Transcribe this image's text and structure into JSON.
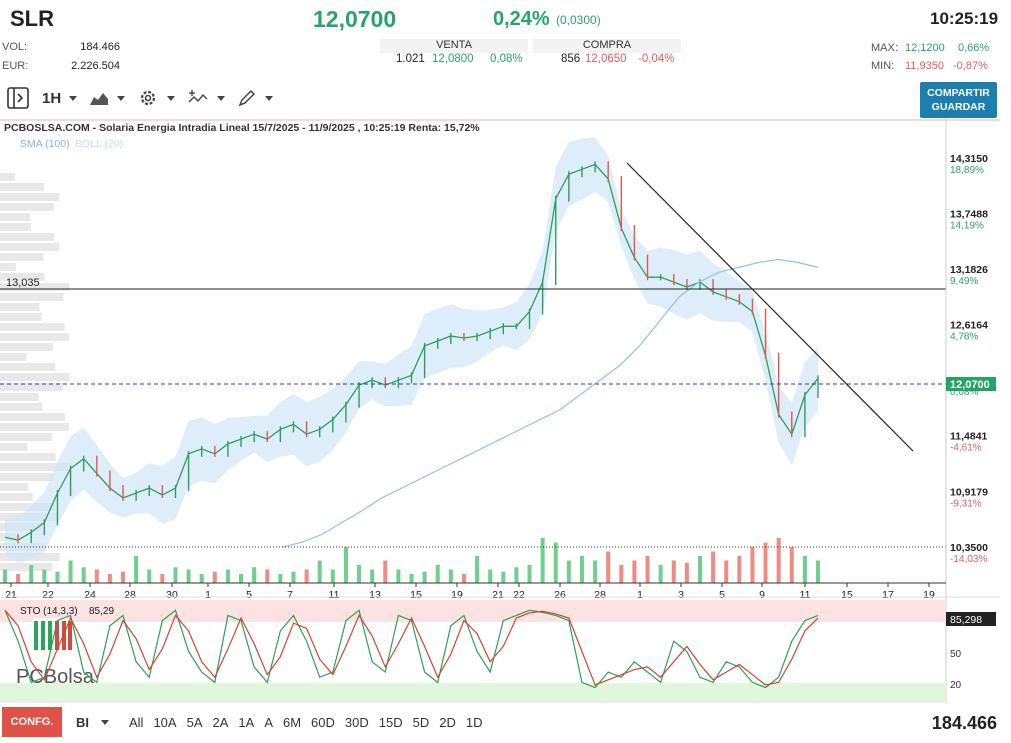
{
  "header": {
    "symbol": "SLR",
    "price": "12,0700",
    "change_pct": "0,24%",
    "change_abs": "(0,0300)",
    "time": "10:25:19"
  },
  "stats": {
    "vol_label": "VOL:",
    "vol_value": "184.466",
    "eur_label": "EUR:",
    "eur_value": "2.226.504",
    "max_label": "MAX:",
    "max_value": "12,1200",
    "max_pct": "0,66%",
    "min_label": "MIN:",
    "min_value": "11,9350",
    "min_pct": "-0,87%"
  },
  "book": {
    "venta_label": "VENTA",
    "venta_qty": "1.021",
    "venta_price": "12,0800",
    "venta_pct": "0,08%",
    "compra_label": "COMPRA",
    "compra_qty": "856",
    "compra_price": "12,0650",
    "compra_pct": "-0,04%"
  },
  "toolbar": {
    "timeframe": "1H",
    "share_line1": "COMPARTIR",
    "share_line2": "GUARDAR"
  },
  "chart_title": "PCBOSLSA.COM - Solaria Energia Intradia Lineal 15/7/2025 - 11/9/2025 , 10:25:19 Renta: 15,72%",
  "indicators_label": {
    "sma": "SMA (100)",
    "boll": "BOLL (20)"
  },
  "hline_label": "13,035",
  "last_label": "12,0700",
  "sto": {
    "label": "STO (14,3,3)",
    "value": "85,29",
    "tag": "85,298",
    "lvl50": "50",
    "lvl20": "20"
  },
  "logo": {
    "text": "PCBolsa"
  },
  "bottom": {
    "conf": "CONFG.",
    "mode": "BI",
    "ranges": [
      "All",
      "10A",
      "5A",
      "2A",
      "1A",
      "A",
      "6M",
      "60D",
      "30D",
      "15D",
      "5D",
      "2D",
      "1D"
    ],
    "volume": "184.466"
  },
  "chart_data": {
    "type": "line",
    "title": "PCBOSLSA.COM - Solaria Energia Intradia Lineal 15/7/2025 - 11/9/2025 , 10:25:19 Renta: 15,72%",
    "y_ticks": [
      {
        "v": 14.315,
        "label": "14,3150",
        "pct": "18,89%",
        "pc": "green"
      },
      {
        "v": 13.7488,
        "label": "13,7488",
        "pct": "14,19%",
        "pc": "green"
      },
      {
        "v": 13.1826,
        "label": "13,1826",
        "pct": "9,49%",
        "pc": "green"
      },
      {
        "v": 12.6164,
        "label": "12,6164",
        "pct": "4,78%",
        "pc": "green"
      },
      {
        "v": 12.0502,
        "label": "12,0502",
        "pct": "0,08%",
        "pc": "green"
      },
      {
        "v": 11.4841,
        "label": "11,4841",
        "pct": "-4,61%",
        "pc": "red"
      },
      {
        "v": 10.9179,
        "label": "10,9179",
        "pct": "-9,31%",
        "pc": "red"
      },
      {
        "v": 10.35,
        "label": "10,3500",
        "pct": "-14,03%",
        "pc": "red"
      }
    ],
    "ylim": [
      10.35,
      14.315
    ],
    "x_ticks": [
      "21",
      "22",
      "24",
      "28",
      "30",
      "1",
      "5",
      "7",
      "11",
      "13",
      "15",
      "19",
      "21",
      "22",
      "26",
      "28",
      "1",
      "3",
      "5",
      "9",
      "11",
      "15",
      "17",
      "19"
    ],
    "price_series": [
      10.45,
      10.42,
      10.5,
      10.6,
      10.9,
      11.15,
      11.25,
      11.1,
      10.95,
      10.85,
      10.9,
      10.95,
      10.88,
      10.95,
      11.3,
      11.35,
      11.3,
      11.4,
      11.45,
      11.5,
      11.45,
      11.55,
      11.6,
      11.5,
      11.55,
      11.65,
      11.8,
      12.0,
      12.05,
      12.0,
      12.05,
      12.1,
      12.4,
      12.45,
      12.5,
      12.48,
      12.5,
      12.55,
      12.6,
      12.6,
      12.75,
      13.05,
      13.9,
      14.15,
      14.2,
      14.25,
      14.1,
      13.6,
      13.3,
      13.1,
      13.1,
      13.05,
      13.0,
      13.05,
      12.95,
      12.9,
      12.85,
      12.75,
      12.3,
      11.7,
      11.5,
      11.9,
      12.07
    ],
    "sma_series": [
      10.35,
      10.4,
      10.48,
      10.6,
      10.72,
      10.85,
      10.95,
      11.05,
      11.15,
      11.25,
      11.35,
      11.45,
      11.55,
      11.65,
      11.75,
      11.9,
      12.05,
      12.2,
      12.4,
      12.65,
      12.9,
      13.05,
      13.15,
      13.2,
      13.25,
      13.28,
      13.25,
      13.2
    ],
    "volume_bars_relative": [
      0.3,
      0.2,
      0.4,
      0.3,
      0.25,
      0.5,
      0.35,
      0.3,
      0.2,
      0.25,
      0.6,
      0.3,
      0.2,
      0.35,
      0.3,
      0.2,
      0.25,
      0.3,
      0.2,
      0.35,
      0.3,
      0.2,
      0.25,
      0.3,
      0.5,
      0.3,
      0.8,
      0.4,
      0.3,
      0.5,
      0.3,
      0.2,
      0.25,
      0.4,
      0.3,
      0.2,
      0.6,
      0.3,
      0.25,
      0.35,
      0.4,
      1.0,
      0.9,
      0.5,
      0.6,
      0.5,
      0.7,
      0.4,
      0.5,
      0.6,
      0.4,
      0.5,
      0.45,
      0.6,
      0.7,
      0.5,
      0.6,
      0.8,
      0.9,
      1.0,
      0.8,
      0.6,
      0.5
    ],
    "sto_series": [
      90,
      60,
      20,
      25,
      80,
      85,
      30,
      20,
      75,
      85,
      40,
      25,
      80,
      90,
      50,
      30,
      20,
      85,
      80,
      35,
      20,
      70,
      85,
      60,
      25,
      30,
      80,
      90,
      40,
      30,
      85,
      80,
      30,
      20,
      75,
      85,
      50,
      30,
      80,
      85,
      90,
      88,
      85,
      80,
      20,
      15,
      30,
      25,
      40,
      30,
      20,
      60,
      50,
      25,
      20,
      40,
      35,
      20,
      15,
      25,
      60,
      80,
      85
    ],
    "hline": 13.035,
    "last": 12.07
  }
}
